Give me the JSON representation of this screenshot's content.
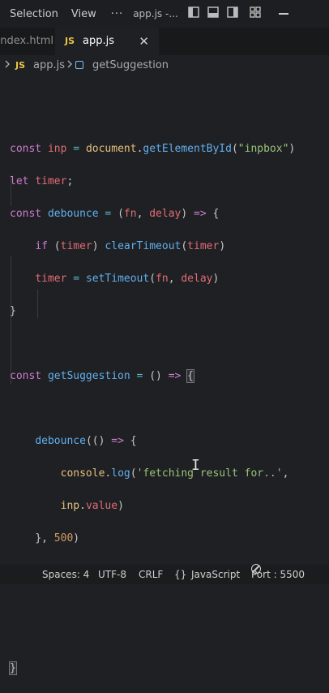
{
  "menu": {
    "items": [
      "Selection",
      "View"
    ],
    "more": "···",
    "window_title": "app.js -..."
  },
  "tabs": {
    "previous": "index.html",
    "active": {
      "badge": "JS",
      "name": "app.js",
      "close": "✕"
    }
  },
  "breadcrumb": {
    "badge": "JS",
    "file": "app.js",
    "symbol": "getSuggestion"
  },
  "code": {
    "line1": {
      "kw": "const",
      "name": "inp",
      "op": "=",
      "obj": "document",
      "method": "getElementById",
      "arg": "\"inpbox\""
    },
    "line2": {
      "kw": "let",
      "name": "timer"
    },
    "line3": {
      "kw": "const",
      "name": "debounce",
      "p1": "fn",
      "p2": "delay"
    },
    "line4": {
      "kw": "if",
      "cond": "timer",
      "call": "clearTimeout",
      "arg": "timer"
    },
    "line5": {
      "name": "timer",
      "call": "setTimeout",
      "a1": "fn",
      "a2": "delay"
    },
    "line7": {
      "kw": "const",
      "name": "getSuggestion"
    },
    "line9": {
      "call": "debounce"
    },
    "line10": {
      "obj": "console",
      "method": "log",
      "arg": "'fetching result for..'"
    },
    "line11": {
      "obj": "inp",
      "prop": "value"
    },
    "line12": {
      "num": "500"
    }
  },
  "status": {
    "spaces": "Spaces: 4",
    "encoding": "UTF-8",
    "eol": "CRLF",
    "lang_icon": "{}",
    "language": "JavaScript",
    "port": "Port : 5500"
  }
}
